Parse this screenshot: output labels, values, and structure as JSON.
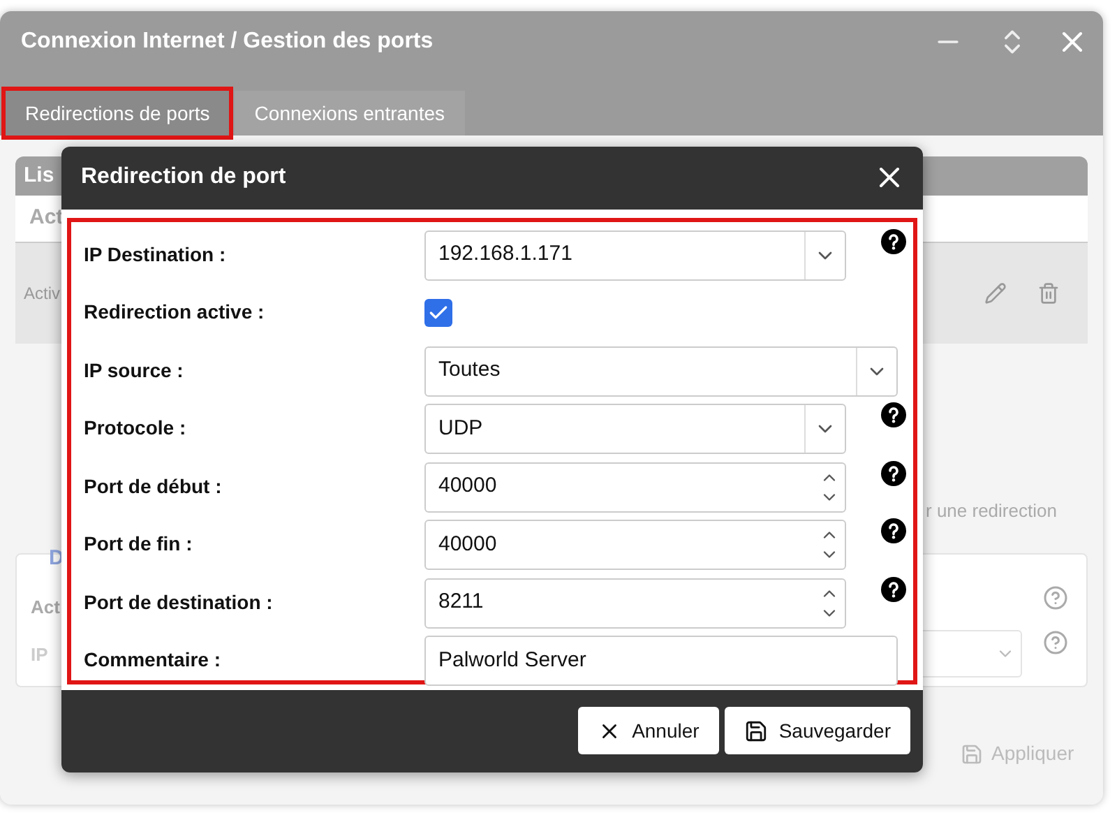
{
  "window": {
    "title": "Connexion Internet / Gestion des ports"
  },
  "tabs": [
    {
      "label": "Redirections de ports",
      "selected": true
    },
    {
      "label": "Connexions entrantes",
      "selected": false
    }
  ],
  "background": {
    "list_title": "Lis",
    "column_1": "Act",
    "row_status": "Activ",
    "hint": "r une redirection",
    "section_title": "D",
    "section_labels": [
      "Act",
      "IP"
    ],
    "apply_button": "Appliquer"
  },
  "dialog": {
    "title": "Redirection de port",
    "fields": [
      {
        "kind": "select",
        "label": "IP Destination :",
        "value": "192.168.1.171",
        "help": true
      },
      {
        "kind": "checkbox",
        "label": "Redirection active :",
        "checked": true,
        "help": false
      },
      {
        "kind": "select",
        "label": "IP source :",
        "value": "Toutes",
        "help": false
      },
      {
        "kind": "select",
        "label": "Protocole :",
        "value": "UDP",
        "help": true
      },
      {
        "kind": "number",
        "label": "Port de début :",
        "value": "40000",
        "help": true
      },
      {
        "kind": "number",
        "label": "Port de fin :",
        "value": "40000",
        "help": true
      },
      {
        "kind": "number",
        "label": "Port de destination :",
        "value": "8211",
        "help": true
      },
      {
        "kind": "text",
        "label": "Commentaire :",
        "value": "Palworld Server",
        "help": false
      }
    ],
    "buttons": [
      {
        "kind": "cancel",
        "label": "Annuler"
      },
      {
        "kind": "save",
        "label": "Sauvegarder"
      }
    ]
  }
}
